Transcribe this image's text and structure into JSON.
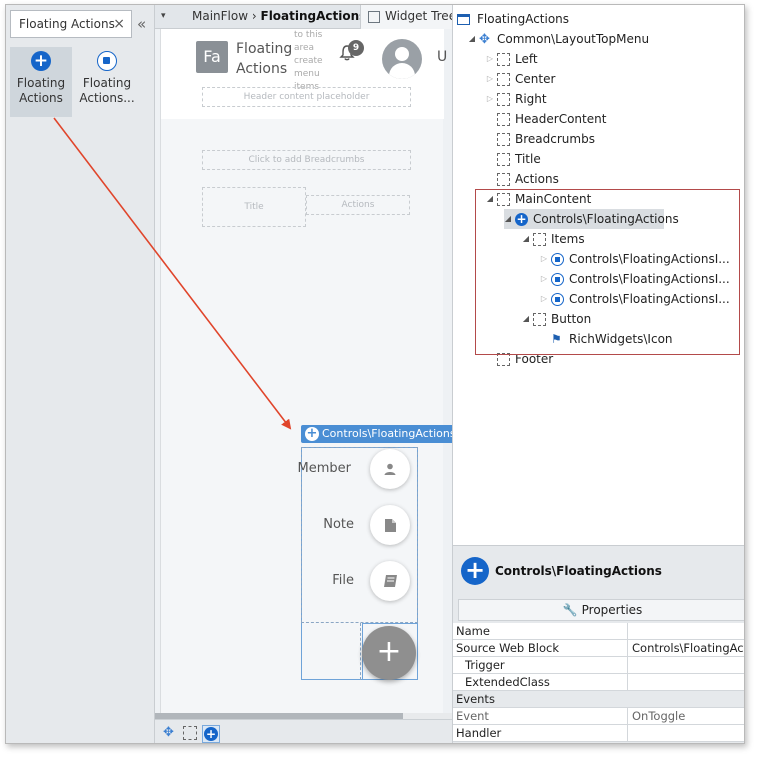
{
  "toolbox": {
    "search_value": "Floating Actions",
    "clear_icon": "×",
    "collapse_icon": "«",
    "items": [
      {
        "label": "Floating Actions",
        "icon": "plus-circle"
      },
      {
        "label": "Floating Actions...",
        "icon": "stop-circle"
      }
    ]
  },
  "canvas": {
    "dropdown_icon": "▾",
    "breadcrumb_prefix": "MainFlow",
    "breadcrumb_current": "FloatingActions",
    "widget_tree_tab": "Widget Tree",
    "app_logo": "Fa",
    "app_name": "Floating Actions",
    "ghost_text": "to this area create menu items",
    "notification_count": "9",
    "user_initial": "U",
    "header_placeholder": "Header content placeholder",
    "breadcrumbs_placeholder": "Click to add Breadcrumbs",
    "title_placeholder": "Title",
    "actions_placeholder": "Actions",
    "block_label": "Controls\\FloatingActions",
    "fa_items": [
      {
        "label": "Member",
        "icon": "person-icon",
        "glyph": "👤"
      },
      {
        "label": "Note",
        "icon": "note-icon",
        "glyph": "▮"
      },
      {
        "label": "File",
        "icon": "book-icon",
        "glyph": "📖"
      }
    ],
    "fa_main_glyph": "+"
  },
  "tree": {
    "root": "FloatingActions",
    "nodes": [
      {
        "label": "Common\\LayoutTopMenu",
        "icon": "puzzle-icon"
      },
      {
        "label": "Left",
        "icon": "placeholder-icon"
      },
      {
        "label": "Center",
        "icon": "placeholder-icon"
      },
      {
        "label": "Right",
        "icon": "placeholder-icon"
      },
      {
        "label": "HeaderContent",
        "icon": "placeholder-icon"
      },
      {
        "label": "Breadcrumbs",
        "icon": "placeholder-icon"
      },
      {
        "label": "Title",
        "icon": "placeholder-icon"
      },
      {
        "label": "Actions",
        "icon": "placeholder-icon"
      },
      {
        "label": "MainContent",
        "icon": "placeholder-icon"
      },
      {
        "label": "Controls\\FloatingActions",
        "icon": "block-icon"
      },
      {
        "label": "Items",
        "icon": "placeholder-icon"
      },
      {
        "label": "Controls\\FloatingActionsI...",
        "icon": "stop-icon"
      },
      {
        "label": "Controls\\FloatingActionsI...",
        "icon": "stop-icon"
      },
      {
        "label": "Controls\\FloatingActionsI...",
        "icon": "stop-icon"
      },
      {
        "label": "Button",
        "icon": "placeholder-icon"
      },
      {
        "label": "RichWidgets\\Icon",
        "icon": "flag-icon"
      },
      {
        "label": "Footer",
        "icon": "placeholder-icon"
      }
    ]
  },
  "properties": {
    "title": "Controls\\FloatingActions",
    "tab_label": "Properties",
    "rows": [
      {
        "name": "Name",
        "value": ""
      },
      {
        "name": "Source Web Block",
        "value": "Controls\\FloatingAct"
      },
      {
        "name": "Trigger",
        "value": ""
      },
      {
        "name": "ExtendedClass",
        "value": ""
      },
      {
        "name": "Events",
        "value": ""
      },
      {
        "name": "Event",
        "value": "OnToggle"
      },
      {
        "name": "Handler",
        "value": ""
      }
    ]
  },
  "colors": {
    "accent": "#1565c9",
    "annotation_arrow": "#e0452b",
    "highlight_box": "#b34a4a"
  }
}
